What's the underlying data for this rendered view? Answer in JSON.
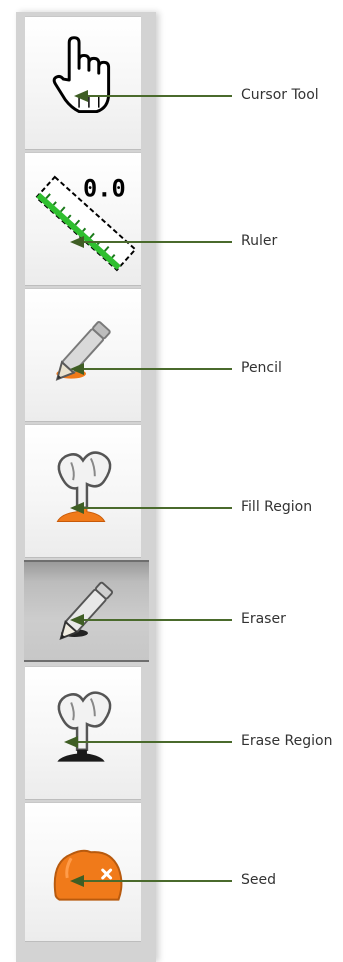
{
  "toolbar": {
    "tools": [
      {
        "label": "Cursor Tool",
        "icon": "hand-cursor-icon",
        "active": false
      },
      {
        "label": "Ruler",
        "icon": "ruler-icon",
        "active": false
      },
      {
        "label": "Pencil",
        "icon": "pencil-icon",
        "active": false
      },
      {
        "label": "Fill Region",
        "icon": "fill-region-icon",
        "active": false
      },
      {
        "label": "Eraser",
        "icon": "eraser-icon",
        "active": true
      },
      {
        "label": "Erase Region",
        "icon": "erase-region-icon",
        "active": false
      },
      {
        "label": "Seed",
        "icon": "seed-icon",
        "active": false
      }
    ],
    "ruler_readout": "0.0"
  },
  "colors": {
    "callout": "#4a6a2c",
    "accent_orange": "#f07a1a",
    "ruler_green": "#2fbf2f",
    "active_background": "#bcbcbc"
  }
}
